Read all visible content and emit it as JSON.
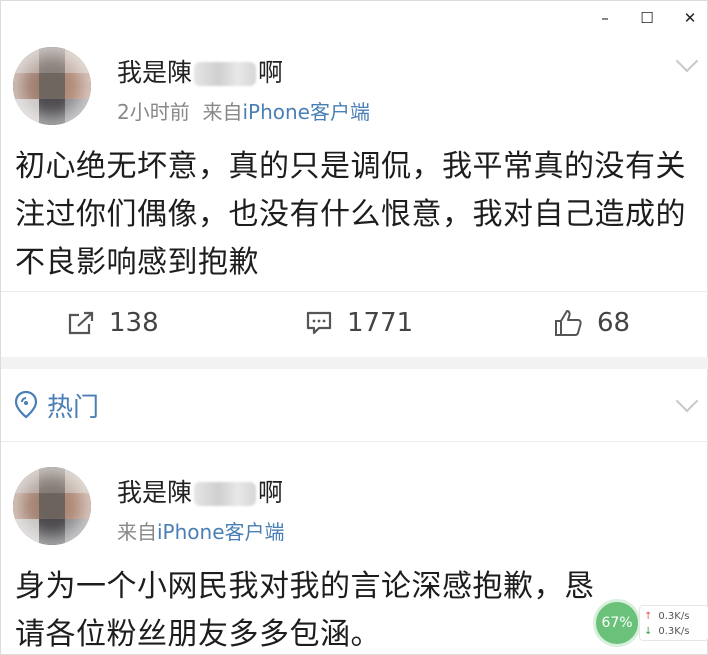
{
  "window_controls": {
    "minimize": "–",
    "maximize": "☐",
    "close": "✕"
  },
  "post1": {
    "user_name_prefix": "我是陳",
    "user_name_suffix": "啊",
    "time": "2小时前",
    "source_prefix": "来自",
    "source": "iPhone客户端",
    "content": "初心绝无坏意，真的只是调侃，我平常真的没有关注过你们偶像，也没有什么恨意，我对自己造成的不良影响感到抱歉",
    "reposts": "138",
    "comments": "1771",
    "likes": "68"
  },
  "hot_section": {
    "label": "热门"
  },
  "post2": {
    "user_name_prefix": "我是陳",
    "user_name_suffix": "啊",
    "source_prefix": "来自",
    "source": "iPhone客户端",
    "content": "身为一个小网民我对我的言论深感抱歉，恳请各位粉丝朋友多多包涵。"
  },
  "speed_widget": {
    "percent": "67%",
    "upload": "0.3K/s",
    "download": "0.3K/s"
  },
  "icons": {
    "repost": "repost-icon",
    "comment": "comment-icon",
    "like": "thumbs-up-icon",
    "hot": "location-pin-icon",
    "expand": "chevron-down-icon"
  },
  "colors": {
    "link_blue": "#4a7fb5",
    "meta_gray": "#888888",
    "speed_green": "#6ac27a"
  }
}
